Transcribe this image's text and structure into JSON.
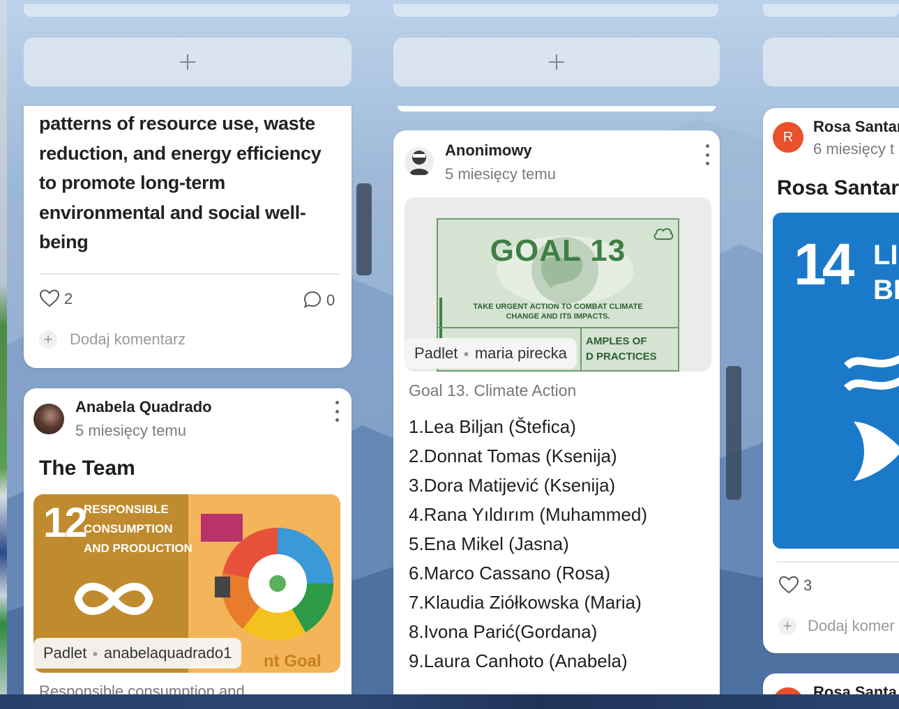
{
  "columns": [
    {
      "add_label": "+",
      "cards": [
        {
          "body_lines": [
            "patterns of resource use, waste",
            "reduction, and energy efficiency",
            "to promote long-term",
            "environmental and social well-",
            "being"
          ],
          "likes": "2",
          "comments": "0",
          "comment_placeholder": "Dodaj komentarz"
        },
        {
          "author": "Anabela Quadrado",
          "time": "5 miesięcy temu",
          "title": "The Team",
          "attachment": {
            "source": "Padlet",
            "owner": "anabelaquadrado1",
            "image_number": "12",
            "image_text_1": "RESPONSIBLE",
            "image_text_2": "CONSUMPTION",
            "image_text_3": "AND PRODUCTION",
            "image_overlay_text": "nt Goal"
          },
          "preview_text": "Responsible consumption and"
        }
      ]
    },
    {
      "add_label": "+",
      "cards": [
        {
          "author": "Anonimowy",
          "time": "5 miesięcy temu",
          "attachment": {
            "source": "Padlet",
            "owner": "maria pirecka",
            "image_heading": "GOAL 13",
            "image_sub_1": "TAKE URGENT ACTION TO COMBAT CLIMATE",
            "image_sub_2": "CHANGE AND ITS IMPACTS.",
            "image_box_1": "AMPLES OF",
            "image_box_2": "D PRACTICES"
          },
          "subtitle": "Goal 13. Climate Action",
          "list": [
            "1.Lea Biljan (Štefica)",
            "2.Donnat Tomas (Ksenija)",
            "3.Dora Matijević (Ksenija)",
            "4.Rana Yıldırım (Muhammed)",
            "5.Ena Mikel (Jasna)",
            "6.Marco Cassano (Rosa)",
            "7.Klaudia Ziółkowska (Maria)",
            "8.Ivona Parić(Gordana)",
            "9.Laura Canhoto (Anabela)"
          ]
        }
      ]
    },
    {
      "cards": [
        {
          "avatar_letter": "R",
          "author": "Rosa Santar",
          "time": "6 miesięcy t",
          "title": "Rosa Santar",
          "image_number": "14",
          "image_text_1": "LIF",
          "image_text_2": "BE",
          "likes": "3",
          "comment_placeholder": "Dodaj komer"
        },
        {
          "author": "Rosa Santa"
        }
      ]
    }
  ],
  "colors": {
    "sdg12": "#bf8b2e",
    "sdg14": "#1a7ac9",
    "goal13_green": "#3f7e44",
    "avatar_r": "#e8512b"
  }
}
